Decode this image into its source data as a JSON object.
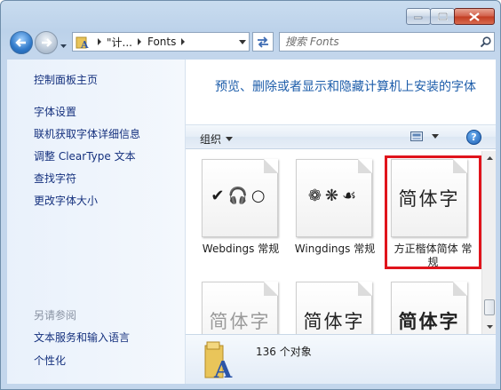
{
  "address": {
    "crumbs": [
      "\"计...",
      "Fonts"
    ]
  },
  "search": {
    "placeholder": "搜索 Fonts"
  },
  "sidebar": {
    "home": "控制面板主页",
    "links": [
      "字体设置",
      "联机获取字体详细信息",
      "调整 ClearType 文本",
      "查找字符",
      "更改字体大小"
    ],
    "see_also_label": "另请参阅",
    "see_also": [
      "文本服务和输入语言",
      "个性化"
    ]
  },
  "main": {
    "headline": "预览、删除或者显示和隐藏计算机上安装的字体",
    "toolbar": {
      "organize_label": "组织"
    },
    "fonts": [
      {
        "name": "Webdings 常规",
        "preview": "✔🎧○"
      },
      {
        "name": "Wingdings 常规",
        "preview": "❁❋☙"
      },
      {
        "name": "方正楷体简体 常规",
        "preview": "简体字"
      },
      {
        "name": "",
        "preview": "简体字"
      },
      {
        "name": "",
        "preview": "简体字"
      },
      {
        "name": "",
        "preview": "简体字"
      }
    ]
  },
  "details": {
    "count": "136 个对象"
  },
  "colors": {
    "highlight_border": "#e0141c",
    "link": "#15317e",
    "headline": "#1d5daa"
  }
}
